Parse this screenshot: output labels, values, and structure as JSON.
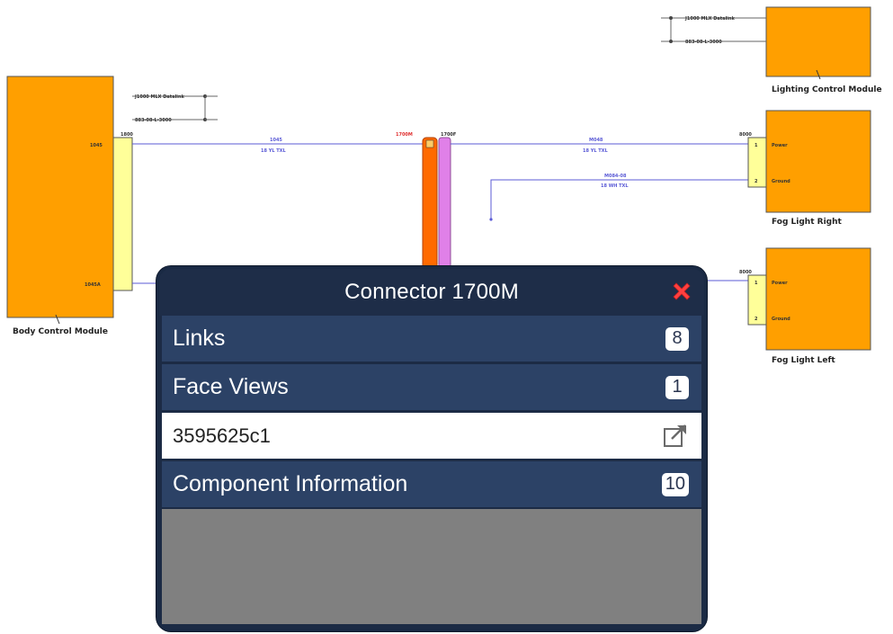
{
  "diagram": {
    "components": {
      "body_control_module": "Body Control Module",
      "lighting_control_module": "Lighting Control Module",
      "fog_light_right": "Fog Light Right",
      "fog_light_left": "Fog Light Left"
    },
    "connector_tags": {
      "c1800": "1800",
      "c1700m": "1700M",
      "c1700f": "1700F",
      "c8000_right": "8000",
      "c8000_left": "8000"
    },
    "pin_labels": {
      "power": "Power",
      "ground": "Ground",
      "p1": "1",
      "p2": "2"
    },
    "wire_labels": {
      "w1": "1045",
      "w1_spec": "18 YL TXL",
      "w2": "M048",
      "w2_spec": "18 YL TXL",
      "w3": "M084-08",
      "w3_spec": "18 WH TXL",
      "pin_bcm_top": "1045",
      "pin_bcm_bottom": "1045A"
    },
    "splice_notes": {
      "bcm_a": "J1000 MLX Datalink",
      "bcm_b": "883-08-L-3000",
      "lcm_a": "J1000 MLX Datalink",
      "lcm_b": "883-08-L-3000"
    },
    "colors": {
      "module_fill": "#ff9f00",
      "connector_fill": "#ffff99",
      "connector_m_fill": "#ff6a00",
      "connector_f_fill": "#e080e8",
      "wire": "#5b5bd6"
    }
  },
  "popup": {
    "title": "Connector 1700M",
    "close_icon": "close-x-icon",
    "rows": [
      {
        "label": "Links",
        "count": "8"
      },
      {
        "label": "Face Views",
        "count": "1"
      },
      {
        "label": "3595625c1",
        "icon": "external-link-icon"
      },
      {
        "label": "Component Information",
        "count": "10"
      }
    ]
  }
}
